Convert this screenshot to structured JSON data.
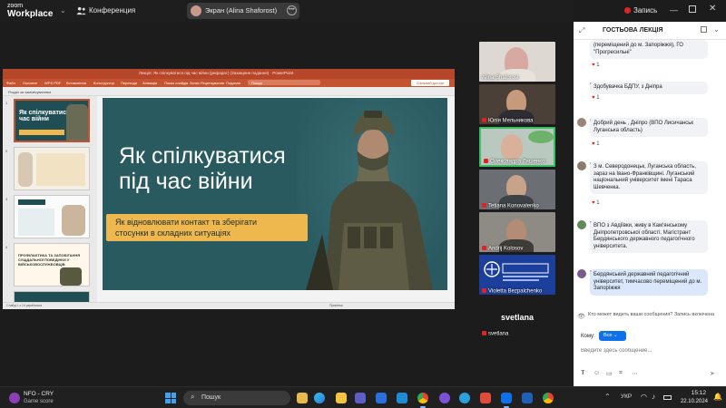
{
  "zoom": {
    "logo_line1": "zoom",
    "logo_line2": "Workplace",
    "conference_label": "Конференция",
    "screen_label": "Экран (Alina Shaforost)",
    "record_label": "Запись"
  },
  "ppt": {
    "window_title": "Лекція: Як спілкуватися під час війни (рефарат) (Захищене подання) · PowerPoint",
    "ribbon": [
      "Файл",
      "Основне",
      "WPS PDF",
      "Вставлення",
      "Конструктор",
      "Переходи",
      "Анімація",
      "Показ слайдів",
      "Запис",
      "Рецензування",
      "Подання"
    ],
    "search_placeholder": "Пошук",
    "share_label": "Спільний доступ",
    "section_label": "Розділ за замовчуванням",
    "thumb1_title": "Як спілкуватися під час війни",
    "thumb4_title": "ПРОФІЛАКТИКА ТА ЗАПОБІГАННЯ СУЦІДАЛЬНОЇ ПОВЕДІНКИ У ВІЙСЬКОВОСЛУЖБОВЦІВ",
    "slide_title_line1": "Як спілкуватися",
    "slide_title_line2": "під час війни",
    "slide_sub_line1": "Як відновлювати контакт та зберігати",
    "slide_sub_line2": "стосунки в складних ситуаціях",
    "status_left": "Слайд 1 з 14   українська",
    "status_right": "Примітки"
  },
  "participants": [
    {
      "name": "Alina Shaforost",
      "muted": false
    },
    {
      "name": "Юлія Мельникова",
      "muted": true
    },
    {
      "name": "Олександра Ляшенко",
      "muted": true
    },
    {
      "name": "Tetiana Konovalenko",
      "muted": true
    },
    {
      "name": "Andrij Kolosov",
      "muted": true
    },
    {
      "name": "Violetta Bezpalchenko",
      "muted": true
    },
    {
      "name": "svetlana",
      "muted": true
    }
  ],
  "svetlana_tile_text": "svetlana",
  "chat": {
    "title": "ГОСТЬОВА ЛЕКЦІЯ",
    "messages": [
      {
        "text": "(переміщений до м. Запоріжжя), ГО \"Прогресильні\"",
        "hearts": "1"
      },
      {
        "sender": "Бур'ян Тетяна",
        "to": "кому",
        "target": "Все",
        "time": "15:11",
        "text": "Здобувачка БДПУ, з Дніпра",
        "hearts": "1"
      },
      {
        "sender": "Юлія КРИЧУН",
        "to": "кому",
        "target": "Все",
        "time": "15:11",
        "text": "Добрий день , Дніпро (ВПО Лисичанськ Луганська область)",
        "hearts": "1"
      },
      {
        "sender": "Катерина Хупіна",
        "to": "кому",
        "target": "Все",
        "time": "15:12",
        "text": "З м. Северодонецьк, Луганська область, зараз на Івано-Франківщині. Луганський національний університет імені Тараса Шевченка.",
        "hearts": "1"
      },
      {
        "sender": "Вікторія Кава",
        "to": "кому",
        "target": "Все",
        "time": "15:12",
        "text": "ВПО з Авдіївки, живу в Кам'янському Дніпропетровської області. Магістрант Бердянського державного педагогічного університета."
      },
      {
        "sender": "Вы",
        "to": "кому",
        "target": "Все",
        "time": "15:12",
        "text": "Бердянський державний педагогічний університет, тимчасово переміщений до м. Запоріжжя"
      }
    ],
    "note": "Кто может видеть ваши сообщения? Запись включена",
    "to_label": "Кому:",
    "to_value": "Все",
    "input_placeholder": "Введите здесь сообщение..."
  },
  "taskbar": {
    "game_line1": "NFO - CRY",
    "game_line2": "Game score",
    "search_label": "Пошук",
    "lang": "УКР",
    "time": "15:12",
    "date": "22.10.2024"
  },
  "colors": {
    "ppt_accent": "#b7472a",
    "slide_bg": "#285a60",
    "slide_banner": "#efb84e",
    "zoom_blue": "#0e71eb",
    "record_red": "#e02424"
  }
}
